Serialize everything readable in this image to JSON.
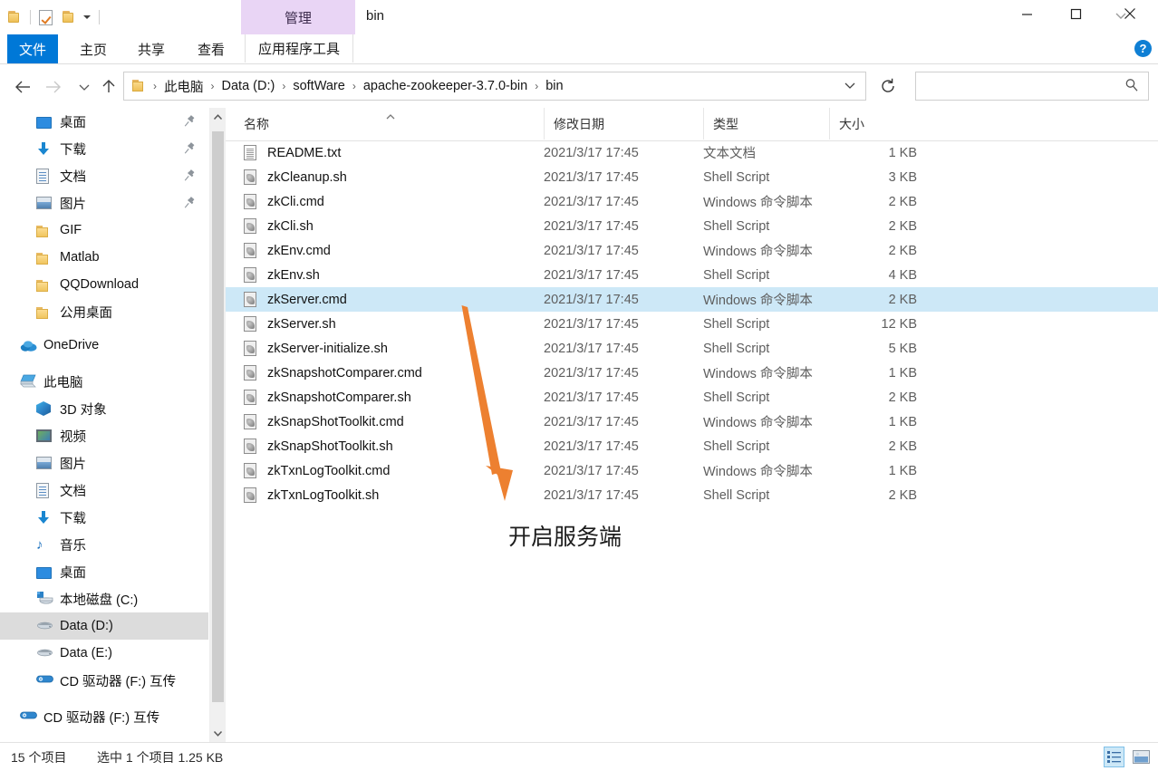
{
  "window": {
    "title": "bin",
    "contextual_tab": "管理",
    "quick_access": [
      "folder-icon",
      "properties-icon",
      "new-folder-icon",
      "customize-caret-icon"
    ],
    "controls": {
      "minimize": "minimize-icon",
      "maximize": "maximize-icon",
      "close": "close-icon",
      "ribbon_toggle": "chevron-down-icon",
      "help": "?"
    }
  },
  "ribbon": {
    "tabs": [
      {
        "label": "文件",
        "active": true
      },
      {
        "label": "主页",
        "active": false
      },
      {
        "label": "共享",
        "active": false
      },
      {
        "label": "查看",
        "active": false
      },
      {
        "label": "应用程序工具",
        "active": false
      }
    ]
  },
  "navigation": {
    "back": "back-arrow-icon",
    "forward": "forward-arrow-icon",
    "recent": "chevron-down-icon",
    "up": "up-arrow-icon",
    "refresh": "refresh-icon",
    "breadcrumb": [
      "此电脑",
      "Data (D:)",
      "softWare",
      "apache-zookeeper-3.7.0-bin",
      "bin"
    ],
    "separator": "›"
  },
  "search": {
    "value": "",
    "placeholder": ""
  },
  "sidebar": {
    "items": [
      {
        "label": "桌面",
        "icon": "desktop-icon",
        "indent": 1,
        "pinned": true
      },
      {
        "label": "下载",
        "icon": "download-icon",
        "indent": 1,
        "pinned": true
      },
      {
        "label": "文档",
        "icon": "documents-icon",
        "indent": 1,
        "pinned": true
      },
      {
        "label": "图片",
        "icon": "pictures-icon",
        "indent": 1,
        "pinned": true
      },
      {
        "label": "GIF",
        "icon": "folder-icon",
        "indent": 1,
        "pinned": false
      },
      {
        "label": "Matlab",
        "icon": "folder-icon",
        "indent": 1,
        "pinned": false
      },
      {
        "label": "QQDownload",
        "icon": "folder-icon",
        "indent": 1,
        "pinned": false
      },
      {
        "label": "公用桌面",
        "icon": "folder-icon",
        "indent": 1,
        "pinned": false
      },
      {
        "label": "OneDrive",
        "icon": "onedrive-icon",
        "indent": 0,
        "pinned": false
      },
      {
        "label": "此电脑",
        "icon": "this-pc-icon",
        "indent": 0,
        "pinned": false
      },
      {
        "label": "3D 对象",
        "icon": "3d-objects-icon",
        "indent": 1,
        "pinned": false
      },
      {
        "label": "视频",
        "icon": "videos-icon",
        "indent": 1,
        "pinned": false
      },
      {
        "label": "图片",
        "icon": "pictures-icon",
        "indent": 1,
        "pinned": false
      },
      {
        "label": "文档",
        "icon": "documents-icon",
        "indent": 1,
        "pinned": false
      },
      {
        "label": "下载",
        "icon": "download-icon",
        "indent": 1,
        "pinned": false
      },
      {
        "label": "音乐",
        "icon": "music-icon",
        "indent": 1,
        "pinned": false
      },
      {
        "label": "桌面",
        "icon": "desktop-icon",
        "indent": 1,
        "pinned": false
      },
      {
        "label": "本地磁盘 (C:)",
        "icon": "system-drive-icon",
        "indent": 1,
        "pinned": false
      },
      {
        "label": "Data (D:)",
        "icon": "drive-icon",
        "indent": 1,
        "pinned": false,
        "selected": true
      },
      {
        "label": "Data (E:)",
        "icon": "drive-icon",
        "indent": 1,
        "pinned": false
      },
      {
        "label": "CD 驱动器 (F:) 互传",
        "icon": "cd-drive-icon",
        "indent": 1,
        "pinned": false
      },
      {
        "label": "CD 驱动器 (F:) 互传",
        "icon": "cd-drive-icon",
        "indent": 0,
        "pinned": false
      }
    ]
  },
  "filelist": {
    "columns": [
      {
        "key": "name",
        "label": "名称",
        "sorted": "asc"
      },
      {
        "key": "date",
        "label": "修改日期"
      },
      {
        "key": "type",
        "label": "类型"
      },
      {
        "key": "size",
        "label": "大小"
      }
    ],
    "rows": [
      {
        "name": "README.txt",
        "date": "2021/3/17 17:45",
        "type": "文本文档",
        "size": "1 KB",
        "icon": "text-file-icon",
        "selected": false
      },
      {
        "name": "zkCleanup.sh",
        "date": "2021/3/17 17:45",
        "type": "Shell Script",
        "size": "3 KB",
        "icon": "script-file-icon",
        "selected": false
      },
      {
        "name": "zkCli.cmd",
        "date": "2021/3/17 17:45",
        "type": "Windows 命令脚本",
        "size": "2 KB",
        "icon": "script-file-icon",
        "selected": false
      },
      {
        "name": "zkCli.sh",
        "date": "2021/3/17 17:45",
        "type": "Shell Script",
        "size": "2 KB",
        "icon": "script-file-icon",
        "selected": false
      },
      {
        "name": "zkEnv.cmd",
        "date": "2021/3/17 17:45",
        "type": "Windows 命令脚本",
        "size": "2 KB",
        "icon": "script-file-icon",
        "selected": false
      },
      {
        "name": "zkEnv.sh",
        "date": "2021/3/17 17:45",
        "type": "Shell Script",
        "size": "4 KB",
        "icon": "script-file-icon",
        "selected": false
      },
      {
        "name": "zkServer.cmd",
        "date": "2021/3/17 17:45",
        "type": "Windows 命令脚本",
        "size": "2 KB",
        "icon": "script-file-icon",
        "selected": true
      },
      {
        "name": "zkServer.sh",
        "date": "2021/3/17 17:45",
        "type": "Shell Script",
        "size": "12 KB",
        "icon": "script-file-icon",
        "selected": false
      },
      {
        "name": "zkServer-initialize.sh",
        "date": "2021/3/17 17:45",
        "type": "Shell Script",
        "size": "5 KB",
        "icon": "script-file-icon",
        "selected": false
      },
      {
        "name": "zkSnapshotComparer.cmd",
        "date": "2021/3/17 17:45",
        "type": "Windows 命令脚本",
        "size": "1 KB",
        "icon": "script-file-icon",
        "selected": false
      },
      {
        "name": "zkSnapshotComparer.sh",
        "date": "2021/3/17 17:45",
        "type": "Shell Script",
        "size": "2 KB",
        "icon": "script-file-icon",
        "selected": false
      },
      {
        "name": "zkSnapShotToolkit.cmd",
        "date": "2021/3/17 17:45",
        "type": "Windows 命令脚本",
        "size": "1 KB",
        "icon": "script-file-icon",
        "selected": false
      },
      {
        "name": "zkSnapShotToolkit.sh",
        "date": "2021/3/17 17:45",
        "type": "Shell Script",
        "size": "2 KB",
        "icon": "script-file-icon",
        "selected": false
      },
      {
        "name": "zkTxnLogToolkit.cmd",
        "date": "2021/3/17 17:45",
        "type": "Windows 命令脚本",
        "size": "1 KB",
        "icon": "script-file-icon",
        "selected": false
      },
      {
        "name": "zkTxnLogToolkit.sh",
        "date": "2021/3/17 17:45",
        "type": "Shell Script",
        "size": "2 KB",
        "icon": "script-file-icon",
        "selected": false
      }
    ]
  },
  "annotation": {
    "text": "开启服务端",
    "arrow_color": "#ed8030"
  },
  "statusbar": {
    "item_count": "15 个项目",
    "selection": "选中 1 个项目  1.25 KB",
    "views": [
      {
        "name": "details-view",
        "active": true
      },
      {
        "name": "large-icons-view",
        "active": false
      }
    ]
  },
  "colors": {
    "accent": "#0078d7",
    "selection": "#cde8f7",
    "contextual_tab": "#e9d5f5",
    "annotation_orange": "#ed8030"
  }
}
